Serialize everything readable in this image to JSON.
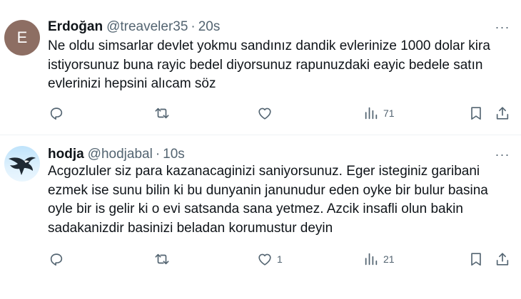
{
  "tweets": [
    {
      "avatar_letter": "E",
      "name": "Erdoğan",
      "handle": "@treaveler35",
      "separator": "·",
      "time": "20s",
      "more": "···",
      "text": "Ne oldu simsarlar devlet yokmu sandınız dandik evlerinize 1000 dolar kira istiyorsunuz buna rayic bedel diyorsunuz rapunuzdaki eayic bedele satın evlerinizi hepsini alıcam söz",
      "likes": "",
      "views": "71"
    },
    {
      "name": "hodja",
      "handle": "@hodjabal",
      "separator": "·",
      "time": "10s",
      "more": "···",
      "text": "Acgozluler siz para kazanacaginizi saniyorsunuz. Eger isteginiz garibani ezmek ise sunu bilin ki bu dunyanin janunudur eden oyke bir bulur basina oyle bir is gelir ki o evi satsanda sana yetmez. Azcik insafli olun bakin sadakanizdir basinizi beladan korumustur deyin",
      "likes": "1",
      "views": "21"
    }
  ],
  "icons": {
    "reply": "reply-icon",
    "retweet": "retweet-icon",
    "like": "heart-icon",
    "views": "views-icon",
    "bookmark": "bookmark-icon",
    "share": "share-icon"
  },
  "colors": {
    "text": "#0f1419",
    "secondary": "#536471",
    "divider": "#eff3f4",
    "avatar_e": "#8d6e63"
  }
}
